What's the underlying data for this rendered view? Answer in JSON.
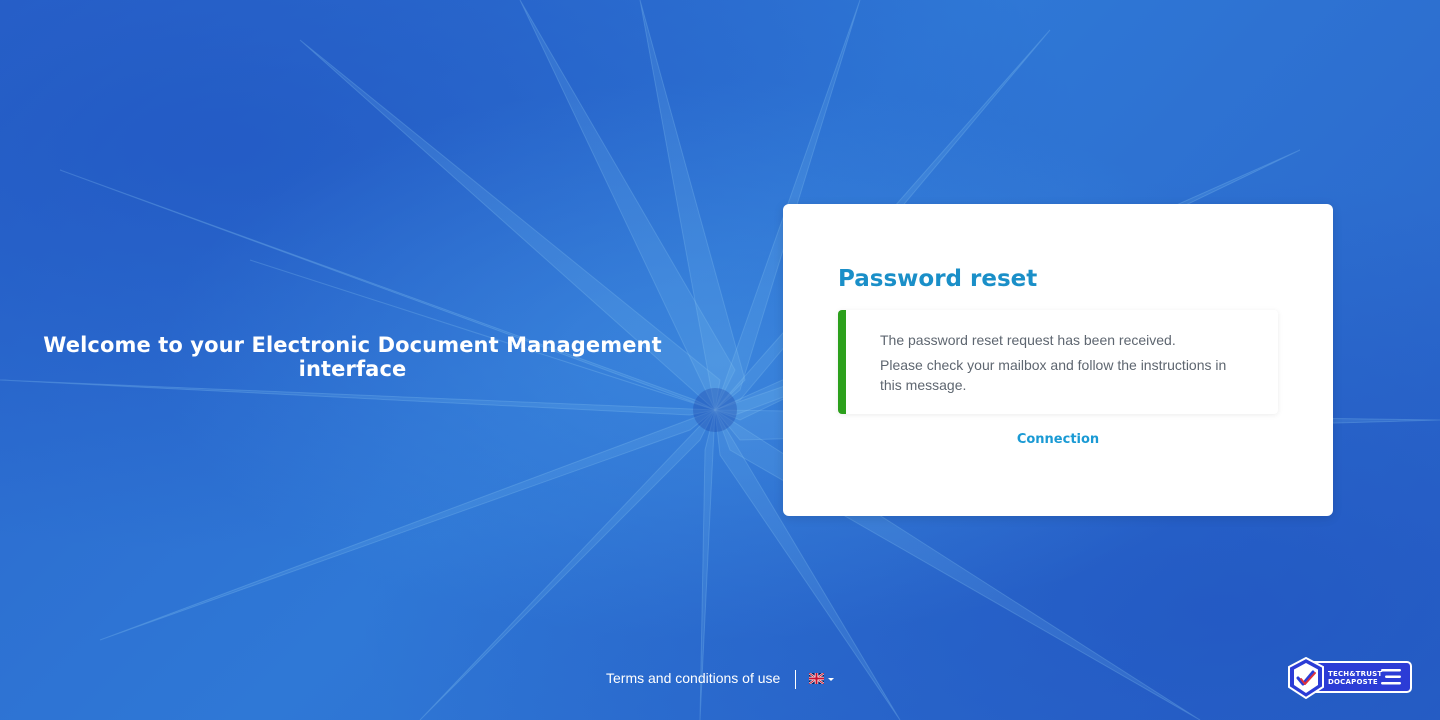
{
  "welcome": {
    "line1": "Welcome to your Electronic Document Management",
    "line2": "interface"
  },
  "card": {
    "title": "Password reset",
    "message_line1": "The password reset request has been received.",
    "message_line2": "Please check your mailbox and follow the instructions in this message.",
    "link_label": "Connection"
  },
  "footer": {
    "terms_label": "Terms and conditions of use",
    "language_flag": "uk-flag-icon"
  },
  "badge": {
    "line1": "TECH&TRUST",
    "line2": "DOCAPOSTE"
  },
  "colors": {
    "background": "#2f6fd2",
    "title": "#1a8fc8",
    "link": "#1a9ad4",
    "success_bar": "#2ca01c",
    "badge": "#2b3cd6"
  }
}
